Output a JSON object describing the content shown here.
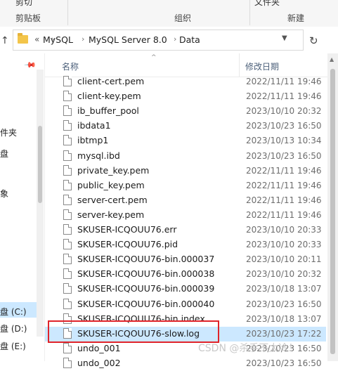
{
  "ribbon": {
    "top_fragment": "剪切",
    "top_fragment_right": "文件夹",
    "groups": [
      "剪贴板",
      "组织",
      "新建"
    ]
  },
  "address": {
    "back_symbol": "«",
    "crumbs": [
      "MySQL",
      "MySQL Server 8.0",
      "Data"
    ],
    "separator": "›"
  },
  "nav": {
    "fragments": [
      "件夹",
      "盘",
      "象",
      "盘 (C:)",
      "盘 (D:)",
      "盘 (E:)"
    ]
  },
  "columns": {
    "name": "名称",
    "modified": "修改日期"
  },
  "files": [
    {
      "name": "client-cert.pem",
      "modified": "2022/11/11 19:46"
    },
    {
      "name": "client-key.pem",
      "modified": "2022/11/11 19:46"
    },
    {
      "name": "ib_buffer_pool",
      "modified": "2023/10/10 20:32"
    },
    {
      "name": "ibdata1",
      "modified": "2023/10/23 16:50"
    },
    {
      "name": "ibtmp1",
      "modified": "2023/10/13 10:34"
    },
    {
      "name": "mysql.ibd",
      "modified": "2023/10/23 16:50"
    },
    {
      "name": "private_key.pem",
      "modified": "2022/11/11 19:46"
    },
    {
      "name": "public_key.pem",
      "modified": "2022/11/11 19:46"
    },
    {
      "name": "server-cert.pem",
      "modified": "2022/11/11 19:46"
    },
    {
      "name": "server-key.pem",
      "modified": "2022/11/11 19:46"
    },
    {
      "name": "SKUSER-ICQOUU76.err",
      "modified": "2023/10/10 20:33"
    },
    {
      "name": "SKUSER-ICQOUU76.pid",
      "modified": "2023/10/10 20:33"
    },
    {
      "name": "SKUSER-ICQOUU76-bin.000037",
      "modified": "2023/10/10 20:11"
    },
    {
      "name": "SKUSER-ICQOUU76-bin.000038",
      "modified": "2023/10/10 20:32"
    },
    {
      "name": "SKUSER-ICQOUU76-bin.000039",
      "modified": "2023/10/18 13:07"
    },
    {
      "name": "SKUSER-ICQOUU76-bin.000040",
      "modified": "2023/10/23 16:50"
    },
    {
      "name": "SKUSER-ICQOUU76-bin.index",
      "modified": "2023/10/18 13:07"
    },
    {
      "name": "SKUSER-ICQOUU76-slow.log",
      "modified": "2023/10/23 17:22"
    },
    {
      "name": "undo_001",
      "modified": "2023/10/23 16:50"
    },
    {
      "name": "undo_002",
      "modified": "2023/10/23 16:50"
    }
  ],
  "selected_file": "SKUSER-ICQOUU76-slow.log",
  "watermark": "CSDN @杀手不太冷！",
  "colors": {
    "highlight_box": "#e0242a",
    "selection": "#cce8ff"
  }
}
